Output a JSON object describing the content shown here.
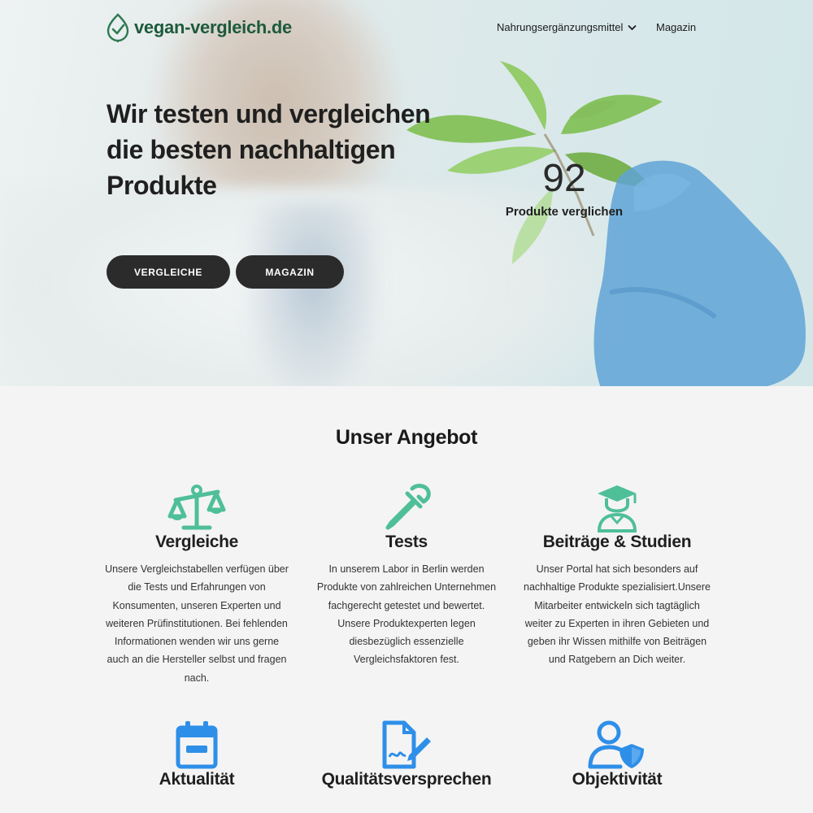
{
  "header": {
    "logo_text": "vegan-vergleich.de",
    "nav": [
      {
        "label": "Nahrungsergänzungsmittel",
        "icon": "chevron-down-icon"
      },
      {
        "label": "Magazin"
      }
    ]
  },
  "hero": {
    "title": "Wir testen und vergleichen die besten nachhaltigen Produkte",
    "buttons": {
      "primary": "VERGLEICHE",
      "secondary": "MAGAZIN"
    },
    "counter": {
      "value": "92",
      "label": "Produkte verglichen"
    }
  },
  "offer": {
    "title": "Unser Angebot",
    "features": [
      {
        "icon": "scale-icon",
        "title": "Vergleiche",
        "text": "Unsere Vergleichstabellen verfügen über die Tests und Erfahrungen von Konsumenten, unseren Experten und weiteren Prüfinstitutionen. Bei fehlenden Informationen wenden wir uns gerne auch an die Hersteller selbst und fragen nach."
      },
      {
        "icon": "pipette-icon",
        "title": "Tests",
        "text": "In unserem Labor in Berlin werden Produkte von zahlreichen Unternehmen fachgerecht getestet und bewertet. Unsere Produktexperten legen diesbezüglich essenzielle Vergleichsfaktoren fest."
      },
      {
        "icon": "graduate-icon",
        "title": "Beiträge & Studien",
        "text": "Unser Portal hat sich besonders auf nachhaltige Produkte spezialisiert.Unsere Mitarbeiter entwickeln sich tagtäglich weiter zu Experten in ihren Gebieten und geben ihr Wissen mithilfe von Beiträgen und Ratgebern an Dich weiter."
      },
      {
        "icon": "calendar-icon",
        "title": "Aktualität"
      },
      {
        "icon": "document-signature-icon",
        "title": "Qualitätsversprechen"
      },
      {
        "icon": "user-shield-icon",
        "title": "Objektivität"
      }
    ]
  },
  "colors": {
    "accent_green": "#4fbf98",
    "accent_blue": "#2e8fe8",
    "button_dark": "#2b2b2b",
    "logo_green": "#1d5a3c"
  }
}
